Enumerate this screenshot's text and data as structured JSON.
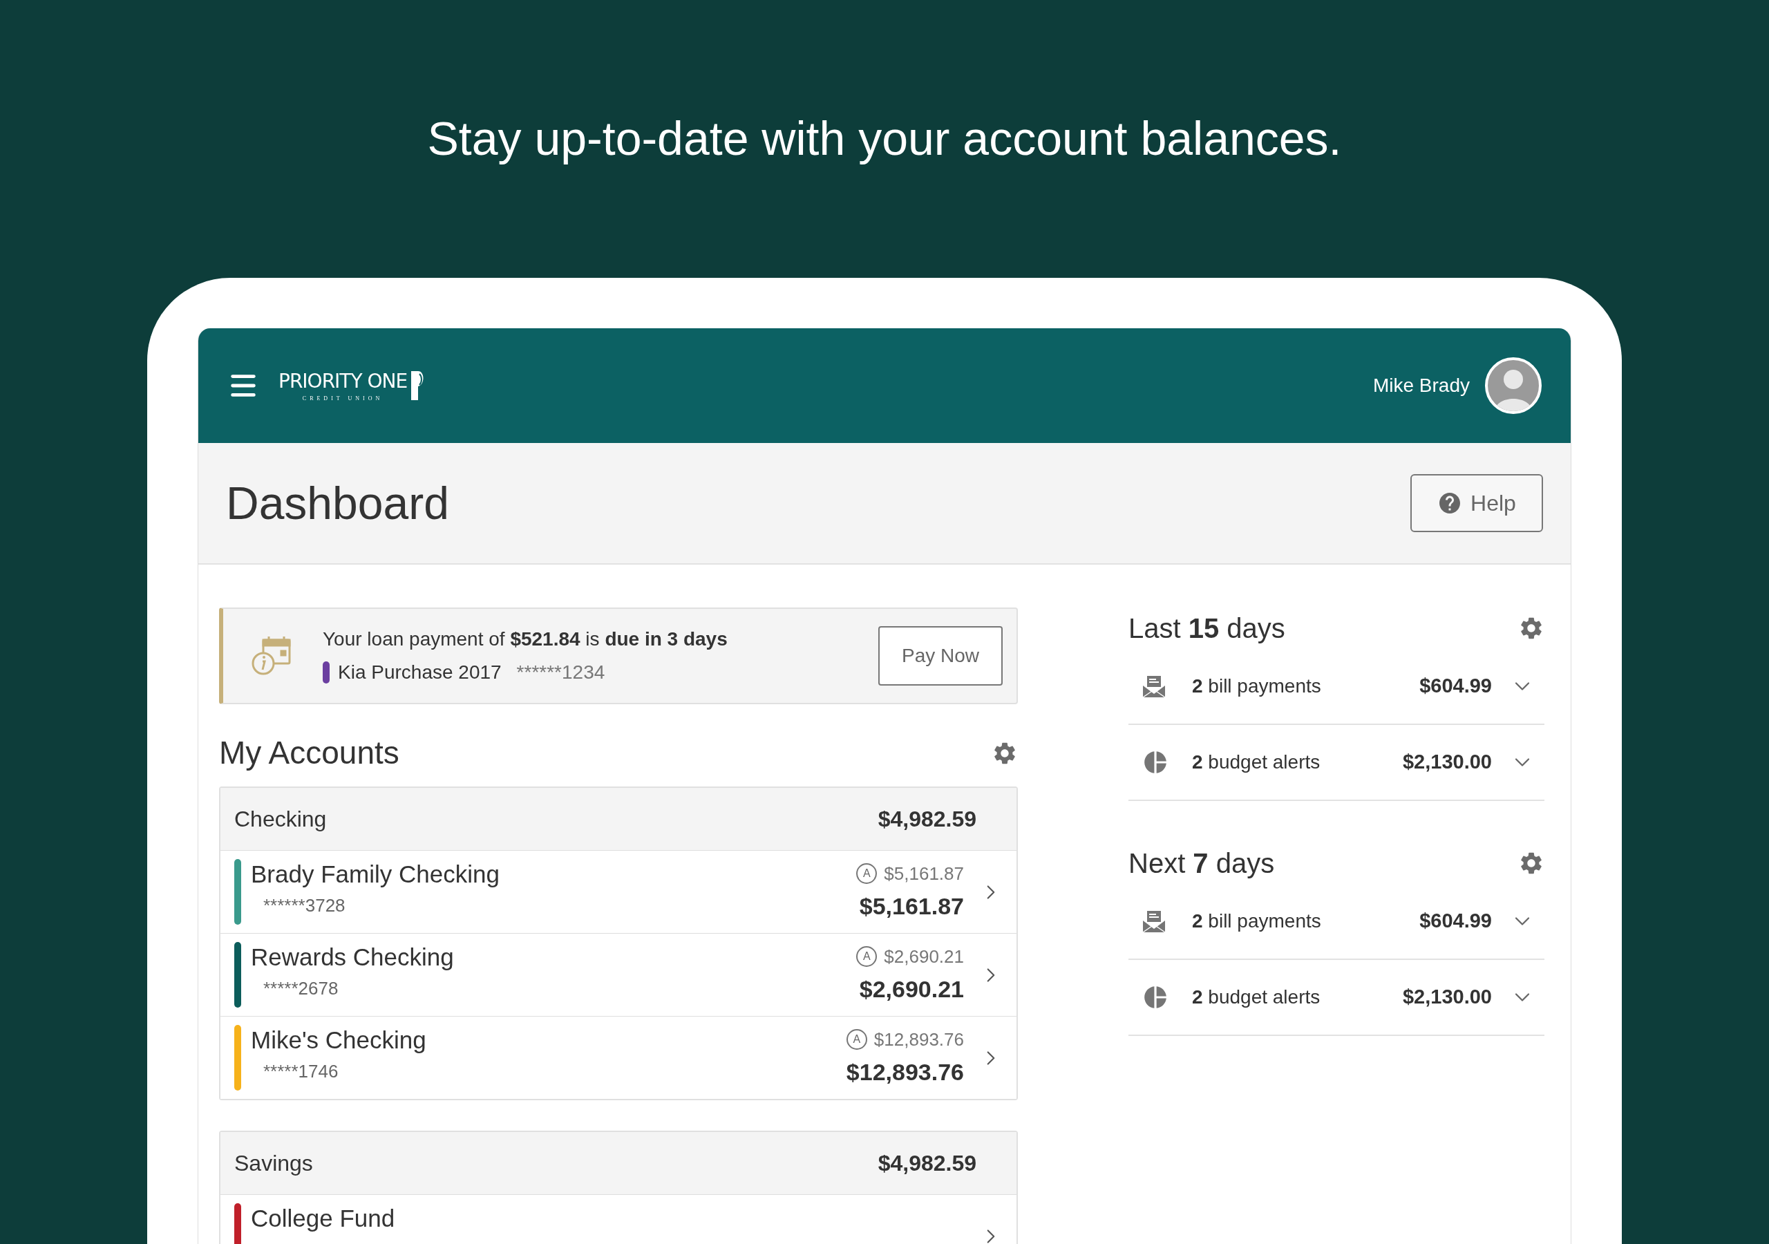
{
  "headline": "Stay up-to-date with your account balances.",
  "header": {
    "logo_name": "PRIORITY ONE",
    "logo_sub": "CREDIT UNION",
    "user_name": "Mike Brady"
  },
  "page": {
    "title": "Dashboard",
    "help_button": "Help"
  },
  "alert": {
    "message": "Your loan payment of **$521.84** is **due in 3 days**",
    "account_name": "Kia Purchase 2017",
    "account_number": "******1234",
    "color": "#6b3fa0",
    "button": "Pay Now"
  },
  "accounts": {
    "title": "My Accounts",
    "groups": [
      {
        "name": "Checking",
        "total": "$4,982.59",
        "accounts": [
          {
            "name": "Brady Family Checking",
            "number": "******3728",
            "available_mark": "A",
            "available": "$5,161.87",
            "balance": "$5,161.87",
            "color": "#3a9a8c"
          },
          {
            "name": "Rewards Checking",
            "number": "*****2678",
            "available_mark": "A",
            "available": "$2,690.21",
            "balance": "$2,690.21",
            "color": "#0c5d5b"
          },
          {
            "name": "Mike's Checking",
            "number": "*****1746",
            "available_mark": "A",
            "available": "$12,893.76",
            "balance": "$12,893.76",
            "color": "#f6b21b"
          }
        ]
      },
      {
        "name": "Savings",
        "total": "$4,982.59",
        "accounts": [
          {
            "name": "College Fund",
            "color": "#c0202a"
          }
        ]
      }
    ]
  },
  "summaries": [
    {
      "title": "Last **15** days",
      "items": [
        {
          "kind": "bill",
          "label": "**2** bill payments",
          "amount": "$604.99"
        },
        {
          "kind": "budget",
          "label": "**2** budget alerts",
          "amount": "$2,130.00"
        }
      ]
    },
    {
      "title": "Next **7** days",
      "items": [
        {
          "kind": "bill",
          "label": "**2** bill payments",
          "amount": "$604.99"
        },
        {
          "kind": "budget",
          "label": "**2** budget alerts",
          "amount": "$2,130.00"
        }
      ]
    }
  ]
}
